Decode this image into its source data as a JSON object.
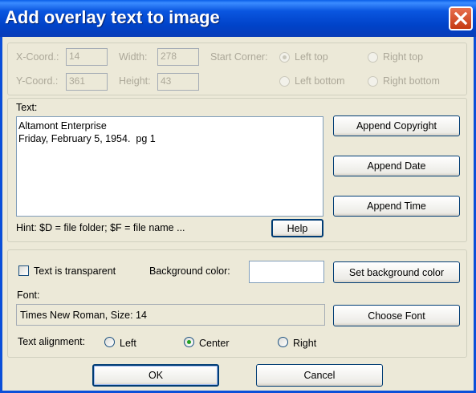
{
  "window": {
    "title": "Add overlay text to image"
  },
  "position": {
    "x_label": "X-Coord.:",
    "x_value": "14",
    "y_label": "Y-Coord.:",
    "y_value": "361",
    "width_label": "Width:",
    "width_value": "278",
    "height_label": "Height:",
    "height_value": "43",
    "start_corner_label": "Start Corner:",
    "corners": [
      "Left top",
      "Right top",
      "Left bottom",
      "Right bottom"
    ]
  },
  "text_section": {
    "label": "Text:",
    "content": "Altamont Enterprise\nFriday, February 5, 1954.  pg 1",
    "hint": "Hint: $D = file folder; $F = file name ...",
    "help_label": "Help",
    "append_copyright_label": "Append Copyright",
    "append_date_label": "Append Date",
    "append_time_label": "Append Time"
  },
  "format_section": {
    "transparent_label": "Text is transparent",
    "transparent_checked": false,
    "bg_color_label": "Background color:",
    "bg_color_value": "#ffffff",
    "set_bg_color_label": "Set background color",
    "font_label": "Font:",
    "font_value": "Times New Roman, Size: 14",
    "choose_font_label": "Choose Font",
    "alignment_label": "Text alignment:",
    "alignment_options": [
      "Left",
      "Center",
      "Right"
    ],
    "alignment_selected": "Center"
  },
  "footer": {
    "ok_label": "OK",
    "cancel_label": "Cancel"
  },
  "colors": {
    "titlebar": "#0a56e0",
    "dialog_bg": "#ece9d8",
    "close_button": "#d9542a"
  }
}
